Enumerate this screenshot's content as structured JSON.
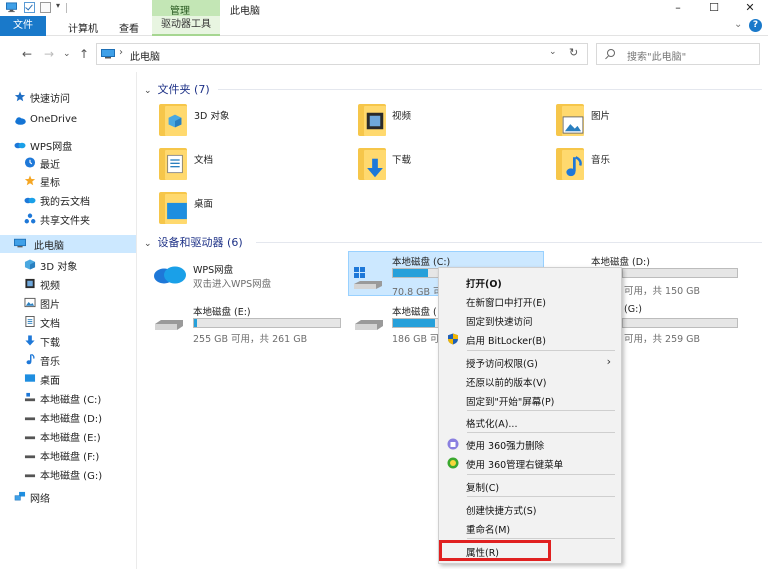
{
  "titlebar": {
    "context_label": "管理",
    "window_title": "此电脑",
    "minimize": "–",
    "maximize": "☐",
    "close": "✕",
    "qa_arrow": "▾"
  },
  "ribbon": {
    "tabs": [
      "文件",
      "计算机",
      "查看"
    ],
    "context_tab": "驱动器工具",
    "chevron": "⌄",
    "help": "?"
  },
  "nav": {
    "back": "←",
    "forward": "→",
    "recent": "⌄",
    "up": "↑",
    "path_sep": "›",
    "path": "此电脑",
    "dropdown": "⌄",
    "refresh": "↻",
    "search_placeholder": "搜索\"此电脑\""
  },
  "sidebar": {
    "items": [
      {
        "label": "快速访问",
        "icon": "star-icon"
      },
      {
        "label": "OneDrive",
        "icon": "cloud-icon"
      },
      {
        "label": "WPS网盘",
        "icon": "wps-cloud-icon"
      },
      {
        "label": "最近",
        "icon": "clock-icon"
      },
      {
        "label": "星标",
        "icon": "star-icon"
      },
      {
        "label": "我的云文档",
        "icon": "cloud-doc-icon"
      },
      {
        "label": "共享文件夹",
        "icon": "share-icon"
      },
      {
        "label": "此电脑",
        "icon": "pc-icon"
      },
      {
        "label": "3D 对象",
        "icon": "cube-icon"
      },
      {
        "label": "视频",
        "icon": "video-icon"
      },
      {
        "label": "图片",
        "icon": "picture-icon"
      },
      {
        "label": "文档",
        "icon": "document-icon"
      },
      {
        "label": "下载",
        "icon": "download-icon"
      },
      {
        "label": "音乐",
        "icon": "music-icon"
      },
      {
        "label": "桌面",
        "icon": "desktop-icon"
      },
      {
        "label": "本地磁盘 (C:)",
        "icon": "drive-c-icon"
      },
      {
        "label": "本地磁盘 (D:)",
        "icon": "drive-icon"
      },
      {
        "label": "本地磁盘 (E:)",
        "icon": "drive-icon"
      },
      {
        "label": "本地磁盘 (F:)",
        "icon": "drive-icon"
      },
      {
        "label": "本地磁盘 (G:)",
        "icon": "drive-icon"
      },
      {
        "label": "网络",
        "icon": "network-icon"
      }
    ]
  },
  "content": {
    "folders_header": "文件夹 (7)",
    "folders": [
      {
        "label": "3D 对象"
      },
      {
        "label": "视频"
      },
      {
        "label": "图片"
      },
      {
        "label": "文档"
      },
      {
        "label": "下载"
      },
      {
        "label": "音乐"
      },
      {
        "label": "桌面"
      }
    ],
    "drives_header": "设备和驱动器 (6)",
    "wps": {
      "name": "WPS网盘",
      "sub": "双击进入WPS网盘"
    },
    "drives": [
      {
        "name": "本地磁盘 (C:)",
        "info": "70.8 GB 可",
        "used_fraction": 0.24
      },
      {
        "name": "本地磁盘 (D:)",
        "info": "可用，共 150 GB",
        "used_fraction": 0.0
      },
      {
        "name": "本地磁盘 (E:)",
        "info": "255 GB 可用，共 261 GB",
        "used_fraction": 0.02
      },
      {
        "name": "本地磁盘 (",
        "info": "186 GB 可",
        "used_fraction": 0.29
      },
      {
        "name": "(G:)",
        "info": "可用，共 259 GB",
        "used_fraction": 0.0
      }
    ]
  },
  "context_menu": {
    "items": [
      {
        "label": "打开(O)"
      },
      {
        "label": "在新窗口中打开(E)"
      },
      {
        "label": "固定到快速访问"
      },
      {
        "label": "启用 BitLocker(B)"
      },
      {
        "label": "授予访问权限(G)",
        "submenu": "›"
      },
      {
        "label": "还原以前的版本(V)"
      },
      {
        "label": "固定到\"开始\"屏幕(P)"
      },
      {
        "label": "格式化(A)..."
      },
      {
        "label": "使用 360强力删除"
      },
      {
        "label": "使用 360管理右键菜单"
      },
      {
        "label": "复制(C)"
      },
      {
        "label": "创建快捷方式(S)"
      },
      {
        "label": "重命名(M)"
      },
      {
        "label": "属性(R)"
      }
    ]
  },
  "colors": {
    "accent": "#1979ca",
    "selection": "#cce8ff",
    "drive_bar": "#26a0da",
    "highlight": "#e02020",
    "folder": "#ffd96e"
  }
}
